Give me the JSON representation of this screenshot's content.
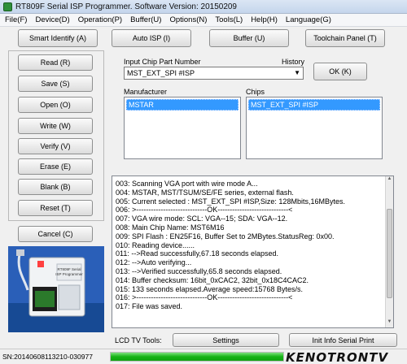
{
  "window": {
    "title": "RT809F Serial ISP Programmer. Software Version: 20150209"
  },
  "menu": [
    "File(F)",
    "Device(D)",
    "Operation(P)",
    "Buffer(U)",
    "Options(N)",
    "Tools(L)",
    "Help(H)",
    "Language(G)"
  ],
  "toolbar": {
    "smart_identify": "Smart Identify (A)",
    "auto_isp": "Auto ISP (I)",
    "buffer": "Buffer (U)",
    "toolchain_panel": "Toolchain Panel (T)"
  },
  "actions": [
    "Read (R)",
    "Save (S)",
    "Open (O)",
    "Write (W)",
    "Verify (V)",
    "Erase (E)",
    "Blank (B)",
    "Reset (T)"
  ],
  "chip_select": {
    "input_label": "Input Chip Part Number",
    "history_label": "History",
    "value": "MST_EXT_SPI #ISP",
    "ok": "OK (K)",
    "manufacturer_label": "Manufacturer",
    "manufacturer_selected": "MSTAR",
    "chips_label": "Chips",
    "chips_selected": "MST_EXT_SPI #ISP"
  },
  "log": [
    "003:  Scanning VGA port with wire mode A...",
    "004:  MSTAR, MST/TSUM/SE/FE series, external flash.",
    "005:  Current selected : MST_EXT_SPI #ISP,Size: 128Mbits,16MBytes.",
    "006:  >-----------------------------OK-----------------------------<",
    "007:  VGA wire mode: SCL: VGA--15; SDA: VGA--12.",
    "008:  Main Chip Name: MST6M16",
    "009:  SPI Flash : EN25F16, Buffer Set to 2MBytes.StatusReg: 0x00.",
    "010:  Reading device......",
    "011:  -->Read successfully,67.18 seconds elapsed.",
    "012:  -->Auto verifying...",
    "013:  -->Verified successfully,65.8 seconds elapsed.",
    "014:  Buffer checksum: 16bit_0xCAC2, 32bit_0x18C4CAC2.",
    "015:  133 seconds elapsed.Average speed:15768 Bytes/s.",
    "016:  >-----------------------------OK-----------------------------<",
    "017:  File was saved."
  ],
  "cancel": "Cancel (C)",
  "tools": {
    "label": "LCD TV Tools:",
    "settings": "Settings",
    "init_info": "Init Info Serial Print"
  },
  "status": {
    "serial": "SN:20140608113210-030977",
    "progress": 1.0
  },
  "device_image": {
    "label_line1": "RT809F Serial",
    "label_line2": "ISP Programmer"
  },
  "watermark": "KENOTRONTV",
  "colors": {
    "selection": "#3399ff",
    "progress": "#16b316"
  }
}
